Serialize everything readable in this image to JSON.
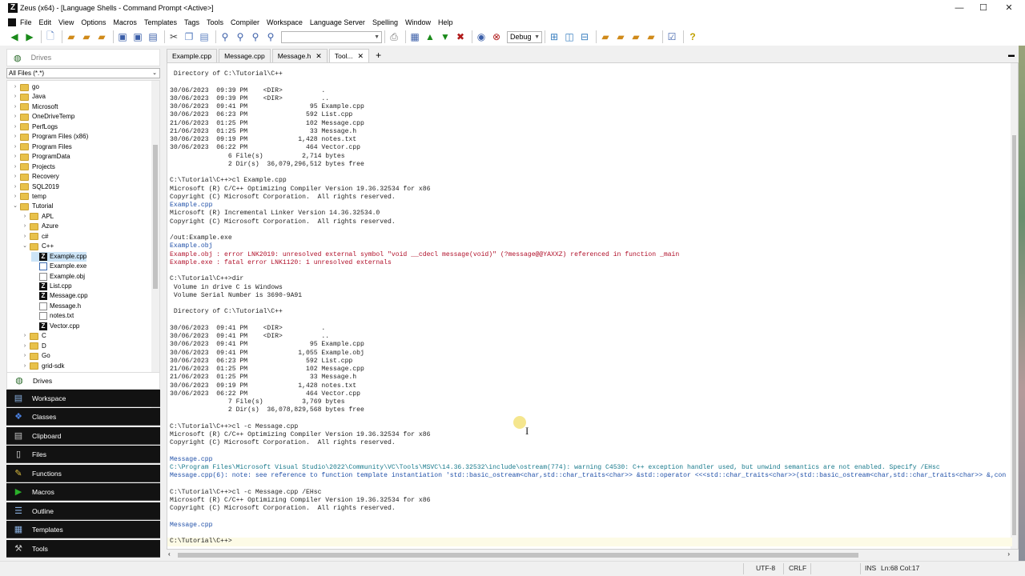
{
  "window": {
    "title": "Zeus (x64) - [Language Shells - Command Prompt <Active>]",
    "logo": "Z",
    "controls": [
      "—",
      "☐",
      "✕"
    ]
  },
  "menu": {
    "items": [
      "File",
      "Edit",
      "View",
      "Options",
      "Macros",
      "Templates",
      "Tags",
      "Tools",
      "Compiler",
      "Workspace",
      "Language Server",
      "Spelling",
      "Window",
      "Help"
    ]
  },
  "toolbar": {
    "search_value": "",
    "config_value": "Debug"
  },
  "left_panel": {
    "drives_title": "Drives",
    "filter_value": "All Files (*.*)",
    "tree": [
      {
        "label": "go",
        "kind": "folder",
        "level": 1,
        "toggle": "›"
      },
      {
        "label": "Java",
        "kind": "folder",
        "level": 1,
        "toggle": "›"
      },
      {
        "label": "Microsoft",
        "kind": "folder",
        "level": 1,
        "toggle": "›"
      },
      {
        "label": "OneDriveTemp",
        "kind": "folder",
        "level": 1,
        "toggle": "›"
      },
      {
        "label": "PerfLogs",
        "kind": "folder",
        "level": 1,
        "toggle": "›"
      },
      {
        "label": "Program Files (x86)",
        "kind": "folder",
        "level": 1,
        "toggle": "›"
      },
      {
        "label": "Program Files",
        "kind": "folder",
        "level": 1,
        "toggle": "›"
      },
      {
        "label": "ProgramData",
        "kind": "folder",
        "level": 1,
        "toggle": "›"
      },
      {
        "label": "Projects",
        "kind": "folder",
        "level": 1,
        "toggle": "›"
      },
      {
        "label": "Recovery",
        "kind": "folder",
        "level": 1,
        "toggle": "›"
      },
      {
        "label": "SQL2019",
        "kind": "folder",
        "level": 1,
        "toggle": "›"
      },
      {
        "label": "temp",
        "kind": "folder",
        "level": 1,
        "toggle": "›"
      },
      {
        "label": "Tutorial",
        "kind": "folder",
        "level": 1,
        "toggle": "⌄"
      },
      {
        "label": "APL",
        "kind": "folder",
        "level": 2,
        "toggle": "›"
      },
      {
        "label": "Azure",
        "kind": "folder",
        "level": 2,
        "toggle": "›"
      },
      {
        "label": "c#",
        "kind": "folder",
        "level": 2,
        "toggle": "›"
      },
      {
        "label": "C++",
        "kind": "folder",
        "level": 2,
        "toggle": "⌄"
      },
      {
        "label": "Example.cpp",
        "kind": "z",
        "level": 3,
        "toggle": "",
        "selected": true
      },
      {
        "label": "Example.exe",
        "kind": "exe",
        "level": 3,
        "toggle": ""
      },
      {
        "label": "Example.obj",
        "kind": "doc",
        "level": 3,
        "toggle": ""
      },
      {
        "label": "List.cpp",
        "kind": "z",
        "level": 3,
        "toggle": ""
      },
      {
        "label": "Message.cpp",
        "kind": "z",
        "level": 3,
        "toggle": ""
      },
      {
        "label": "Message.h",
        "kind": "doc",
        "level": 3,
        "toggle": ""
      },
      {
        "label": "notes.txt",
        "kind": "doc",
        "level": 3,
        "toggle": ""
      },
      {
        "label": "Vector.cpp",
        "kind": "z",
        "level": 3,
        "toggle": ""
      },
      {
        "label": "C",
        "kind": "folder",
        "level": 2,
        "toggle": "›"
      },
      {
        "label": "D",
        "kind": "folder",
        "level": 2,
        "toggle": "›"
      },
      {
        "label": "Go",
        "kind": "folder",
        "level": 2,
        "toggle": "›"
      },
      {
        "label": "grid-sdk",
        "kind": "folder",
        "level": 2,
        "toggle": "›"
      }
    ],
    "panels": [
      "Drives",
      "Workspace",
      "Classes",
      "Clipboard",
      "Files",
      "Functions",
      "Macros",
      "Outline",
      "Templates",
      "Tools"
    ]
  },
  "tabs": [
    {
      "label": "Example.cpp",
      "active": false
    },
    {
      "label": "Message.cpp",
      "active": false
    },
    {
      "label": "Message.h",
      "active": false
    },
    {
      "label": "Tool...",
      "active": true
    }
  ],
  "editor": {
    "lines": [
      {
        "text": " Directory of C:\\Tutorial\\C++",
        "style": ""
      },
      {
        "text": "",
        "style": ""
      },
      {
        "text": "30/06/2023  09:39 PM    <DIR>          .",
        "style": ""
      },
      {
        "text": "30/06/2023  09:39 PM    <DIR>          ..",
        "style": ""
      },
      {
        "text": "30/06/2023  09:41 PM                95 Example.cpp",
        "style": ""
      },
      {
        "text": "30/06/2023  06:23 PM               592 List.cpp",
        "style": ""
      },
      {
        "text": "21/06/2023  01:25 PM               102 Message.cpp",
        "style": ""
      },
      {
        "text": "21/06/2023  01:25 PM                33 Message.h",
        "style": ""
      },
      {
        "text": "30/06/2023  09:19 PM             1,428 notes.txt",
        "style": ""
      },
      {
        "text": "30/06/2023  06:22 PM               464 Vector.cpp",
        "style": ""
      },
      {
        "text": "               6 File(s)          2,714 bytes",
        "style": ""
      },
      {
        "text": "               2 Dir(s)  36,079,296,512 bytes free",
        "style": ""
      },
      {
        "text": "",
        "style": ""
      },
      {
        "text": "C:\\Tutorial\\C++>cl Example.cpp",
        "style": ""
      },
      {
        "text": "Microsoft (R) C/C++ Optimizing Compiler Version 19.36.32534 for x86",
        "style": ""
      },
      {
        "text": "Copyright (C) Microsoft Corporation.  All rights reserved.",
        "style": ""
      },
      {
        "text": "Example.cpp",
        "style": "blue"
      },
      {
        "text": "Microsoft (R) Incremental Linker Version 14.36.32534.0",
        "style": ""
      },
      {
        "text": "Copyright (C) Microsoft Corporation.  All rights reserved.",
        "style": ""
      },
      {
        "text": "",
        "style": ""
      },
      {
        "text": "/out:Example.exe",
        "style": ""
      },
      {
        "text": "Example.obj",
        "style": "blue"
      },
      {
        "text": "Example.obj : error LNK2019: unresolved external symbol \"void __cdecl message(void)\" (?message@@YAXXZ) referenced in function _main",
        "style": "red"
      },
      {
        "text": "Example.exe : fatal error LNK1120: 1 unresolved externals",
        "style": "red"
      },
      {
        "text": "",
        "style": ""
      },
      {
        "text": "C:\\Tutorial\\C++>dir",
        "style": ""
      },
      {
        "text": " Volume in drive C is Windows",
        "style": ""
      },
      {
        "text": " Volume Serial Number is 3690-9A91",
        "style": ""
      },
      {
        "text": "",
        "style": ""
      },
      {
        "text": " Directory of C:\\Tutorial\\C++",
        "style": ""
      },
      {
        "text": "",
        "style": ""
      },
      {
        "text": "30/06/2023  09:41 PM    <DIR>          .",
        "style": ""
      },
      {
        "text": "30/06/2023  09:41 PM    <DIR>          ..",
        "style": ""
      },
      {
        "text": "30/06/2023  09:41 PM                95 Example.cpp",
        "style": ""
      },
      {
        "text": "30/06/2023  09:41 PM             1,055 Example.obj",
        "style": ""
      },
      {
        "text": "30/06/2023  06:23 PM               592 List.cpp",
        "style": ""
      },
      {
        "text": "21/06/2023  01:25 PM               102 Message.cpp",
        "style": ""
      },
      {
        "text": "21/06/2023  01:25 PM                33 Message.h",
        "style": ""
      },
      {
        "text": "30/06/2023  09:19 PM             1,428 notes.txt",
        "style": ""
      },
      {
        "text": "30/06/2023  06:22 PM               464 Vector.cpp",
        "style": ""
      },
      {
        "text": "               7 File(s)          3,769 bytes",
        "style": ""
      },
      {
        "text": "               2 Dir(s)  36,078,829,568 bytes free",
        "style": ""
      },
      {
        "text": "",
        "style": ""
      },
      {
        "text": "C:\\Tutorial\\C++>cl -c Message.cpp",
        "style": ""
      },
      {
        "text": "Microsoft (R) C/C++ Optimizing Compiler Version 19.36.32534 for x86",
        "style": ""
      },
      {
        "text": "Copyright (C) Microsoft Corporation.  All rights reserved.",
        "style": ""
      },
      {
        "text": "",
        "style": ""
      },
      {
        "text": "Message.cpp",
        "style": "blue"
      },
      {
        "text": "C:\\Program Files\\Microsoft Visual Studio\\2022\\Community\\VC\\Tools\\MSVC\\14.36.32532\\include\\ostream(774): warning C4530: C++ exception handler used, but unwind semantics are not enabled. Specify /EHsc",
        "style": "teal"
      },
      {
        "text": "Message.cpp(6): note: see reference to function template instantiation 'std::basic_ostream<char,std::char_traits<char>> &std::operator <<<std::char_traits<char>>(std::basic_ostream<char,std::char_traits<char>> &,con",
        "style": "blue"
      },
      {
        "text": "",
        "style": ""
      },
      {
        "text": "C:\\Tutorial\\C++>cl -c Message.cpp /EHsc",
        "style": ""
      },
      {
        "text": "Microsoft (R) C/C++ Optimizing Compiler Version 19.36.32534 for x86",
        "style": ""
      },
      {
        "text": "Copyright (C) Microsoft Corporation.  All rights reserved.",
        "style": ""
      },
      {
        "text": "",
        "style": ""
      },
      {
        "text": "Message.cpp",
        "style": "blue"
      },
      {
        "text": "",
        "style": ""
      },
      {
        "text": "C:\\Tutorial\\C++>",
        "style": ""
      }
    ]
  },
  "status": {
    "encoding": "UTF-8",
    "line_ending": "CRLF",
    "mode": "INS",
    "position": "Ln:68 Col:17"
  },
  "colors": {
    "error": "#b0102a",
    "info": "#1f4fa8",
    "warning": "#187a8c",
    "panel_bg": "#121212"
  }
}
